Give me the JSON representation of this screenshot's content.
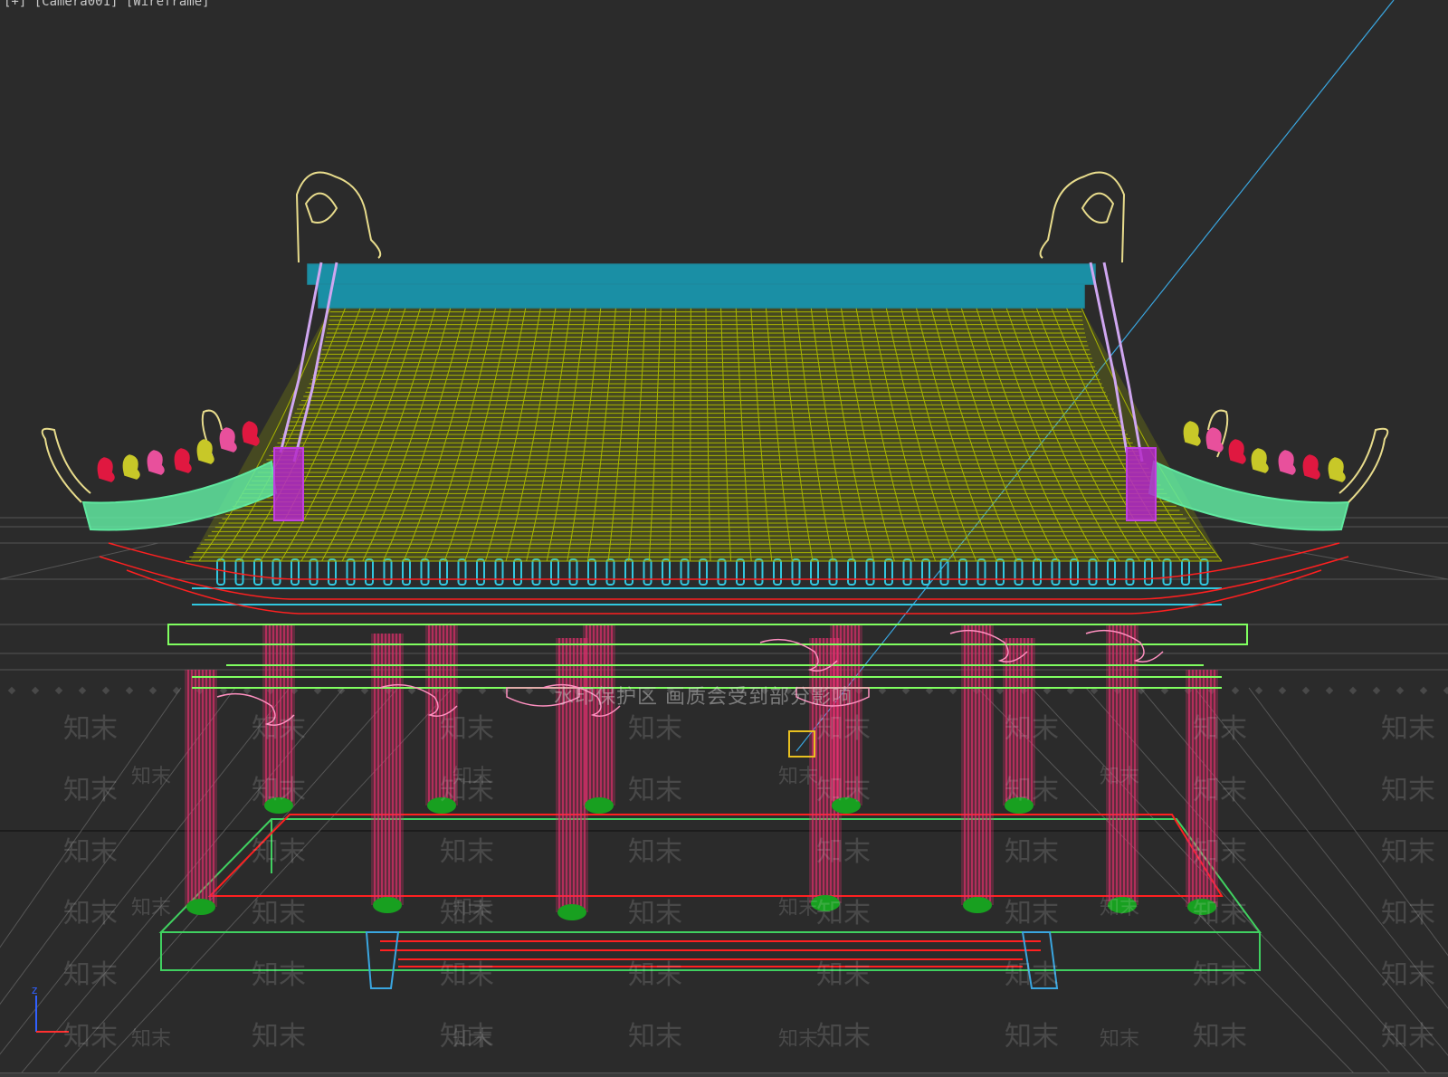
{
  "viewport": {
    "label": "[+] [Camera001] [Wireframe]",
    "notice": "水印保护区  画质会受到部分影响",
    "watermark": "知末"
  },
  "colors": {
    "background": "#2b2b2b",
    "grid": "#7a7a7a",
    "roof_tiles": "#a8b400",
    "ridge": "#1c8a9e",
    "eave_ridges": "#cfa6f0",
    "corner_tiles": "#60e8a0",
    "columns": "#e0306c",
    "column_bases": "#18a020",
    "rafters": "#30c8e0",
    "beams": "#80ff60",
    "brackets": "#ff90c0",
    "ornaments": "#e8dc8c",
    "figurines": [
      "#e01840",
      "#c8c828",
      "#e8509c"
    ],
    "platform": "#40d060",
    "platform_inner": "#ff2020",
    "camera_line": "#3aa6e0"
  },
  "icons": [
    "axis-gizmo-icon",
    "selection-marker-icon"
  ]
}
